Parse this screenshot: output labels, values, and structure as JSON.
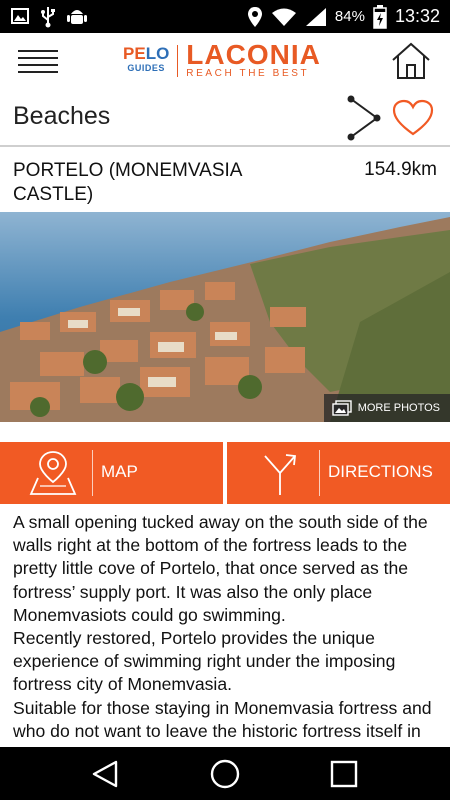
{
  "status_bar": {
    "time": "13:32",
    "battery": "84%",
    "icons": [
      "image-icon",
      "usb-icon",
      "android-debug-icon",
      "location-icon",
      "wifi-icon",
      "signal-icon",
      "battery-charging-icon"
    ]
  },
  "app_bar": {
    "logo": {
      "pelo_left": "PE",
      "pelo_right": "LO",
      "guides": "GUIDES",
      "name": "LACONIA",
      "tagline": "REACH THE BEST"
    },
    "menu_icon": "hamburger-icon",
    "home_icon": "home-icon"
  },
  "section": {
    "title": "Beaches",
    "share_icon": "share-icon",
    "favorite_icon": "heart-outline-icon"
  },
  "place": {
    "name": "PORTELO (MONEMVASIA CASTLE)",
    "distance": "154.9km"
  },
  "photo": {
    "more_photos_label": "MORE PHOTOS"
  },
  "actions": {
    "map_label": "MAP",
    "directions_label": "DIRECTIONS"
  },
  "description": {
    "paragraphs": [
      "A small opening tucked away on the south side of the walls right at the bottom of the fortress leads to the pretty little cove of Portelo, that once served as the fortress’ supply port. It was also the only place Monemvasiots could go swimming.",
      "Recently restored, Portelo provides the unique experience of swimming right under the imposing fortress city of Monemvasia.",
      "Suitable for those staying in Monemvasia fortress and who do not want to leave the historic fortress itself in order to swim."
    ]
  },
  "colors": {
    "accent": "#f15a24",
    "brand_blue": "#2e6fb7"
  }
}
